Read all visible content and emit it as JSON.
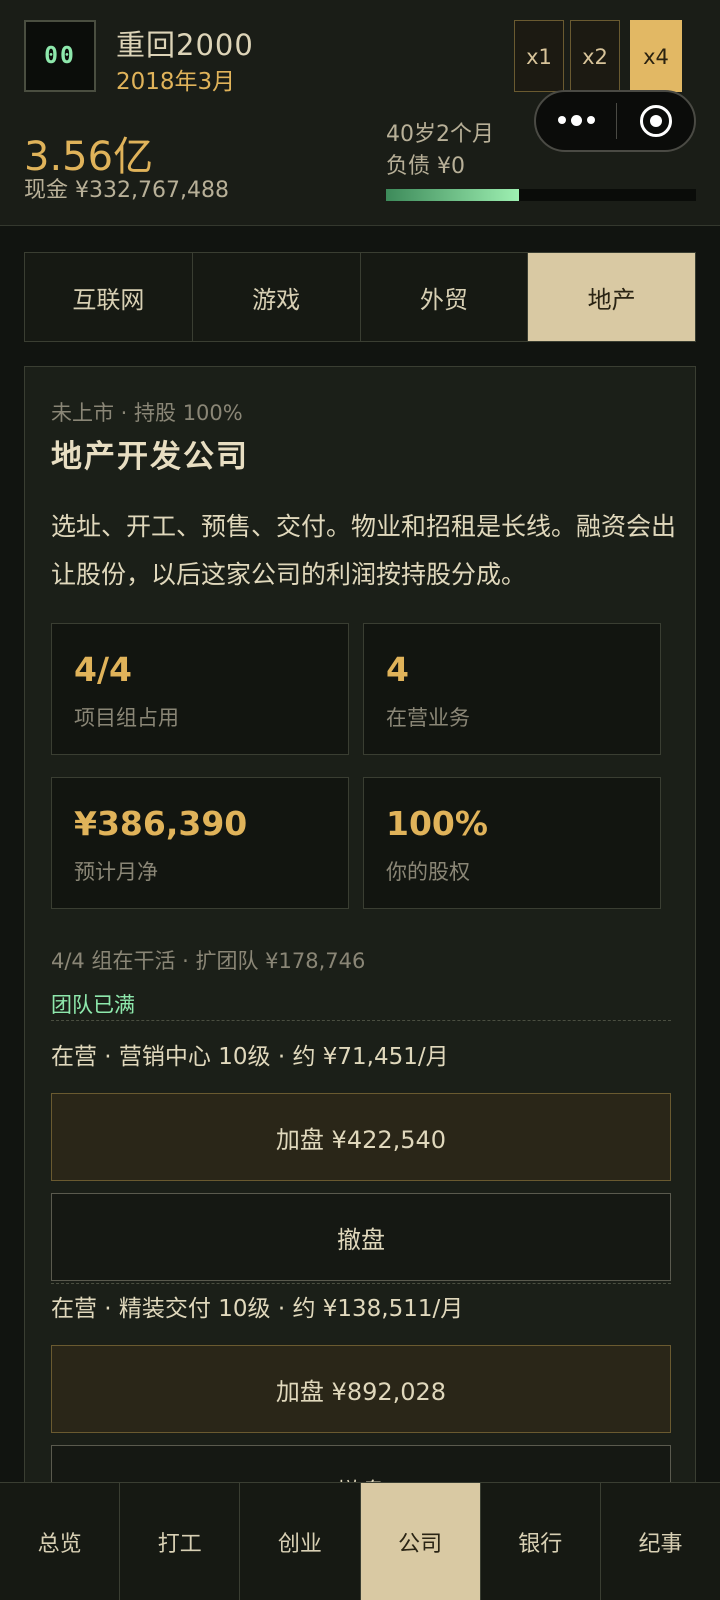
{
  "header": {
    "tick": "00",
    "title": "重回2000",
    "date": "2018年3月",
    "speed_buttons": [
      "x1",
      "x2",
      "x4"
    ],
    "active_speed": "x4",
    "net_worth": "3.56亿",
    "cash": "现金 ¥332,767,488",
    "age": "40岁2个月",
    "debt": "负债 ¥0",
    "age_progress": 0.43,
    "capsule": {
      "more_icon": "more-dots-icon",
      "close_icon": "target-circle-icon"
    }
  },
  "tabs": {
    "items": [
      "互联网",
      "游戏",
      "外贸",
      "地产"
    ],
    "active": "地产"
  },
  "company": {
    "status": "未上市 · 持股 100%",
    "name": "地产开发公司",
    "description": "选址、开工、预售、交付。物业和招租是长线。融资会出让股份，以后这家公司的利润按持股分成。",
    "stats": [
      {
        "value": "4/4",
        "label": "项目组占用"
      },
      {
        "value": "4",
        "label": "在营业务"
      },
      {
        "value": "¥386,390",
        "label": "预计月净"
      },
      {
        "value": "100%",
        "label": "你的股权"
      }
    ],
    "team_line": "4/4 组在干活 · 扩团队 ¥178,746",
    "team_full": "团队已满",
    "businesses": [
      {
        "title": "在营 · 营销中心 10级 · 约 ¥71,451/月",
        "add_label": "加盘 ¥422,540",
        "remove_label": "撤盘"
      },
      {
        "title": "在营 · 精装交付 10级 · 约 ¥138,511/月",
        "add_label": "加盘 ¥892,028",
        "remove_label": "撤盘"
      }
    ]
  },
  "bottom_nav": {
    "items": [
      "总览",
      "打工",
      "创业",
      "公司",
      "银行",
      "纪事"
    ],
    "active": "公司"
  }
}
